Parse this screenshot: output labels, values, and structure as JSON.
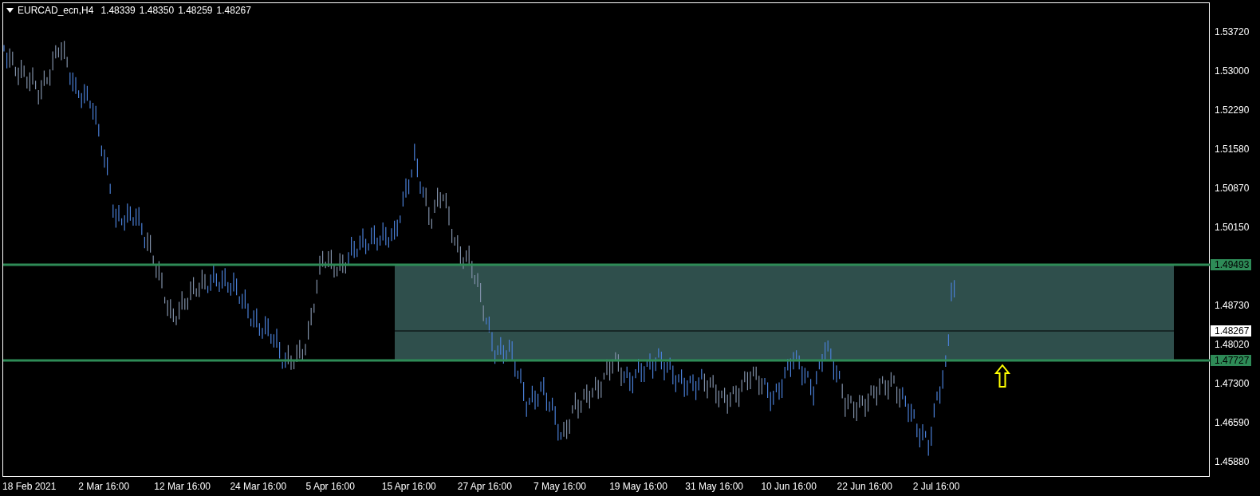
{
  "header": {
    "symbol": "EURCAD_ecn,H4",
    "quotes": [
      "1.48339",
      "1.48350",
      "1.48259",
      "1.48267"
    ]
  },
  "price_axis": [
    {
      "label": "1.53720",
      "kind": "tick"
    },
    {
      "label": "1.53000",
      "kind": "tick"
    },
    {
      "label": "1.52290",
      "kind": "tick"
    },
    {
      "label": "1.51580",
      "kind": "tick"
    },
    {
      "label": "1.50870",
      "kind": "tick"
    },
    {
      "label": "1.50150",
      "kind": "tick"
    },
    {
      "label": "1.49493",
      "kind": "level"
    },
    {
      "label": "1.48730",
      "kind": "tick"
    },
    {
      "label": "1.48267",
      "kind": "current"
    },
    {
      "label": "1.48020",
      "kind": "tick"
    },
    {
      "label": "1.47727",
      "kind": "level"
    },
    {
      "label": "1.47300",
      "kind": "tick"
    },
    {
      "label": "1.46590",
      "kind": "tick"
    },
    {
      "label": "1.45880",
      "kind": "tick"
    }
  ],
  "time_axis": [
    "18 Feb 2021",
    "2 Mar 16:00",
    "12 Mar 16:00",
    "24 Mar 16:00",
    "5 Apr 16:00",
    "15 Apr 16:00",
    "27 Apr 16:00",
    "7 May 16:00",
    "19 May 16:00",
    "31 May 16:00",
    "10 Jun 16:00",
    "22 Jun 16:00",
    "2 Jul 16:00"
  ]
}
